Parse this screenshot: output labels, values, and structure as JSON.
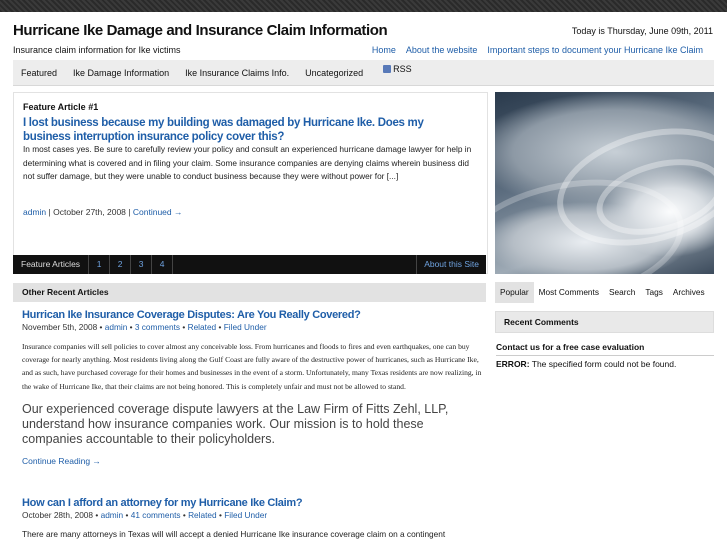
{
  "header": {
    "title": "Hurricane Ike Damage and Insurance Claim Information",
    "tagline": "Insurance claim information for Ike victims",
    "date": "Today is Thursday, June 09th, 2011",
    "links": [
      "Home",
      "About the website",
      "Important steps to document your Hurricane Ike Claim"
    ]
  },
  "nav": {
    "items": [
      "Featured",
      "Ike Damage Information",
      "Ike Insurance Claims Info.",
      "Uncategorized"
    ],
    "rss": "RSS"
  },
  "feature": {
    "label": "Feature Article #1",
    "headline": "I lost business because my building was damaged by Hurricane Ike. Does my business interruption insurance policy cover this?",
    "excerpt": "In most cases yes.  Be sure to carefully review your policy and consult an experienced hurricane damage lawyer for help in determining what is covered and in filing your claim.  Some insurance companies are denying claims wherein business did not suffer damage, but they were unable to conduct business because they were without power for [...]",
    "author": "admin",
    "date": "October 27th, 2008",
    "continued": "Continued →",
    "bar_label": "Feature Articles",
    "pages": [
      "1",
      "2",
      "3",
      "4"
    ],
    "about": "About this Site"
  },
  "other": {
    "heading": "Other Recent Articles",
    "post1": {
      "title": "Hurrican Ike Insurance Coverage Disputes: Are You Really Covered?",
      "date": "November 5th, 2008",
      "author": "admin",
      "comments": "3 comments",
      "related": "Related",
      "filed": "Filed Under",
      "body": "Insurance companies will sell policies to cover almost any conceivable loss. From hurricanes and floods to fires and even earthquakes, one can buy coverage for nearly anything.  Most residents living along the Gulf Coast are fully aware of the destructive power of hurricanes, such as Hurricane Ike, and as such, have purchased coverage for their homes and businesses in the event of a storm. Unfortunately, many Texas residents are now realizing, in the wake of Hurricane Ike, that their claims are not being honored. This is completely unfair and must not be allowed to stand.",
      "big": "Our experienced coverage dispute lawyers at the Law Firm of Fitts Zehl, LLP, understand how insurance companies work. Our mission is to hold these companies accountable to their policyholders.",
      "continue": "Continue Reading →"
    },
    "post2": {
      "title": "How can I afford an attorney for my Hurricane Ike Claim?",
      "date": "October 28th, 2008",
      "author": "admin",
      "comments": "41 comments",
      "related": "Related",
      "filed": "Filed Under",
      "body": "There are many attorneys in Texas will will accept a denied Hurricane Ike insurance coverage claim on a contingent"
    }
  },
  "sidebar": {
    "tabs": [
      "Popular",
      "Most Comments",
      "Search",
      "Tags",
      "Archives"
    ],
    "recent_comments": "Recent Comments",
    "contact": "Contact us for a free case evaluation",
    "error_label": "ERROR:",
    "error_text": "The specified form could not be found."
  }
}
